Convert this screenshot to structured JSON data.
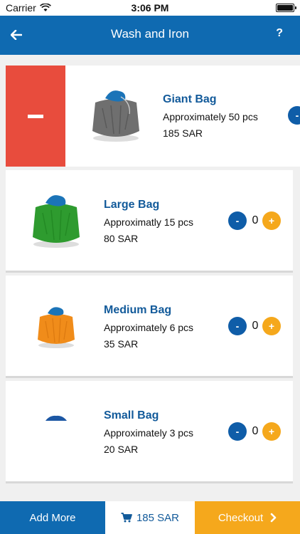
{
  "status_bar": {
    "carrier": "Carrier",
    "time": "3:06 PM"
  },
  "nav": {
    "title": "Wash and Iron",
    "help": "?",
    "back_icon": "back-arrow-icon"
  },
  "bags": [
    {
      "title": "Giant Bag",
      "desc": "Approximately 50 pcs",
      "price": "185 SAR",
      "color": "#6f6f6f",
      "minus": "-"
    },
    {
      "title": "Large Bag",
      "desc": "Approximatly 15 pcs",
      "price": "80 SAR",
      "color": "#2e9b2f",
      "minus": "-",
      "plus": "+",
      "qty": "0"
    },
    {
      "title": "Medium Bag",
      "desc": "Approximately 6 pcs",
      "price": "35 SAR",
      "color": "#f08c1a",
      "minus": "-",
      "plus": "+",
      "qty": "0"
    },
    {
      "title": "Small Bag",
      "desc": "Approximately 3 pcs",
      "price": "20 SAR",
      "color": "#1c57a4",
      "minus": "-",
      "plus": "+",
      "qty": "0"
    }
  ],
  "bottom": {
    "add_more": "Add More",
    "total": "185 SAR",
    "checkout": "Checkout"
  },
  "colors": {
    "brand_blue": "#0f6ab1",
    "accent_orange": "#f5a81c",
    "delete_red": "#e84c3d"
  }
}
